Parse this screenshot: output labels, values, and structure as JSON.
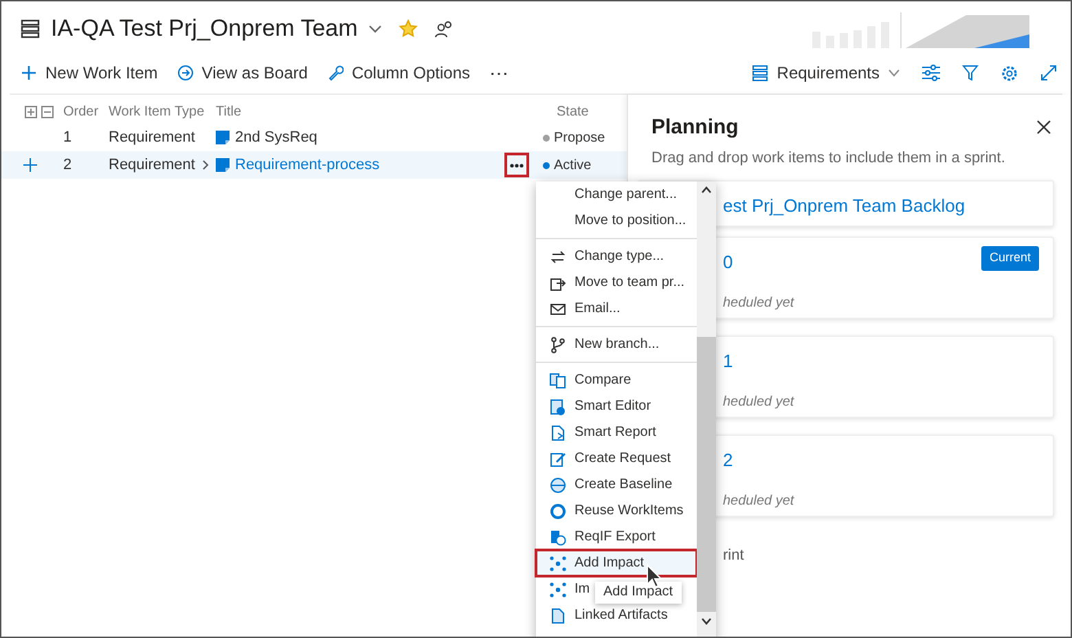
{
  "header": {
    "title": "IA-QA Test Prj_Onprem Team",
    "favorite": true
  },
  "toolbar": {
    "actions": [
      "New Work Item",
      "View as Board",
      "Column Options",
      "⋯"
    ],
    "level_picker": "Requirements"
  },
  "grid": {
    "columns": [
      "Order",
      "Work Item Type",
      "Title",
      "State"
    ],
    "rows": [
      {
        "order": "1",
        "type": "Requirement",
        "title": "2nd SysReq",
        "state": "Propose",
        "color": "#a0a0a0",
        "selected": false,
        "has_children": false
      },
      {
        "order": "2",
        "type": "Requirement",
        "title": "Requirement-process",
        "state": "Active",
        "color": "#0078d4",
        "selected": true,
        "has_children": true
      }
    ]
  },
  "planning": {
    "title": "Planning",
    "subtitle": "Drag and drop work items to include them in a sprint.",
    "cards": [
      {
        "title": "est Prj_Onprem Team Backlog"
      },
      {
        "title": "0",
        "badge": "Current",
        "note": "heduled yet"
      },
      {
        "title": "1",
        "note": "heduled yet"
      },
      {
        "title": "2",
        "note": "heduled yet"
      }
    ],
    "footer": "rint"
  },
  "context_menu": {
    "groups": [
      [
        {
          "label": "Change parent...",
          "selected": false
        },
        {
          "label": "Move to position...",
          "selected": false
        }
      ],
      [
        {
          "label": "Change type...",
          "selected": false
        },
        {
          "label": "Move to team pr...",
          "selected": false
        },
        {
          "label": "Email...",
          "selected": false
        }
      ],
      [
        {
          "label": "New branch...",
          "selected": false
        }
      ],
      [
        {
          "label": "Compare",
          "selected": false
        },
        {
          "label": "Smart Editor",
          "selected": false
        },
        {
          "label": "Smart Report",
          "selected": false
        },
        {
          "label": "Create Request",
          "selected": false
        },
        {
          "label": "Create Baseline",
          "selected": false
        },
        {
          "label": "Reuse WorkItems",
          "selected": false
        },
        {
          "label": "ReqIF Export",
          "selected": false
        },
        {
          "label": "Add Impact",
          "selected": true
        },
        {
          "label": "Im",
          "selected": false
        },
        {
          "label": "Linked Artifacts",
          "selected": false
        }
      ]
    ]
  },
  "tooltip": "Add Impact"
}
